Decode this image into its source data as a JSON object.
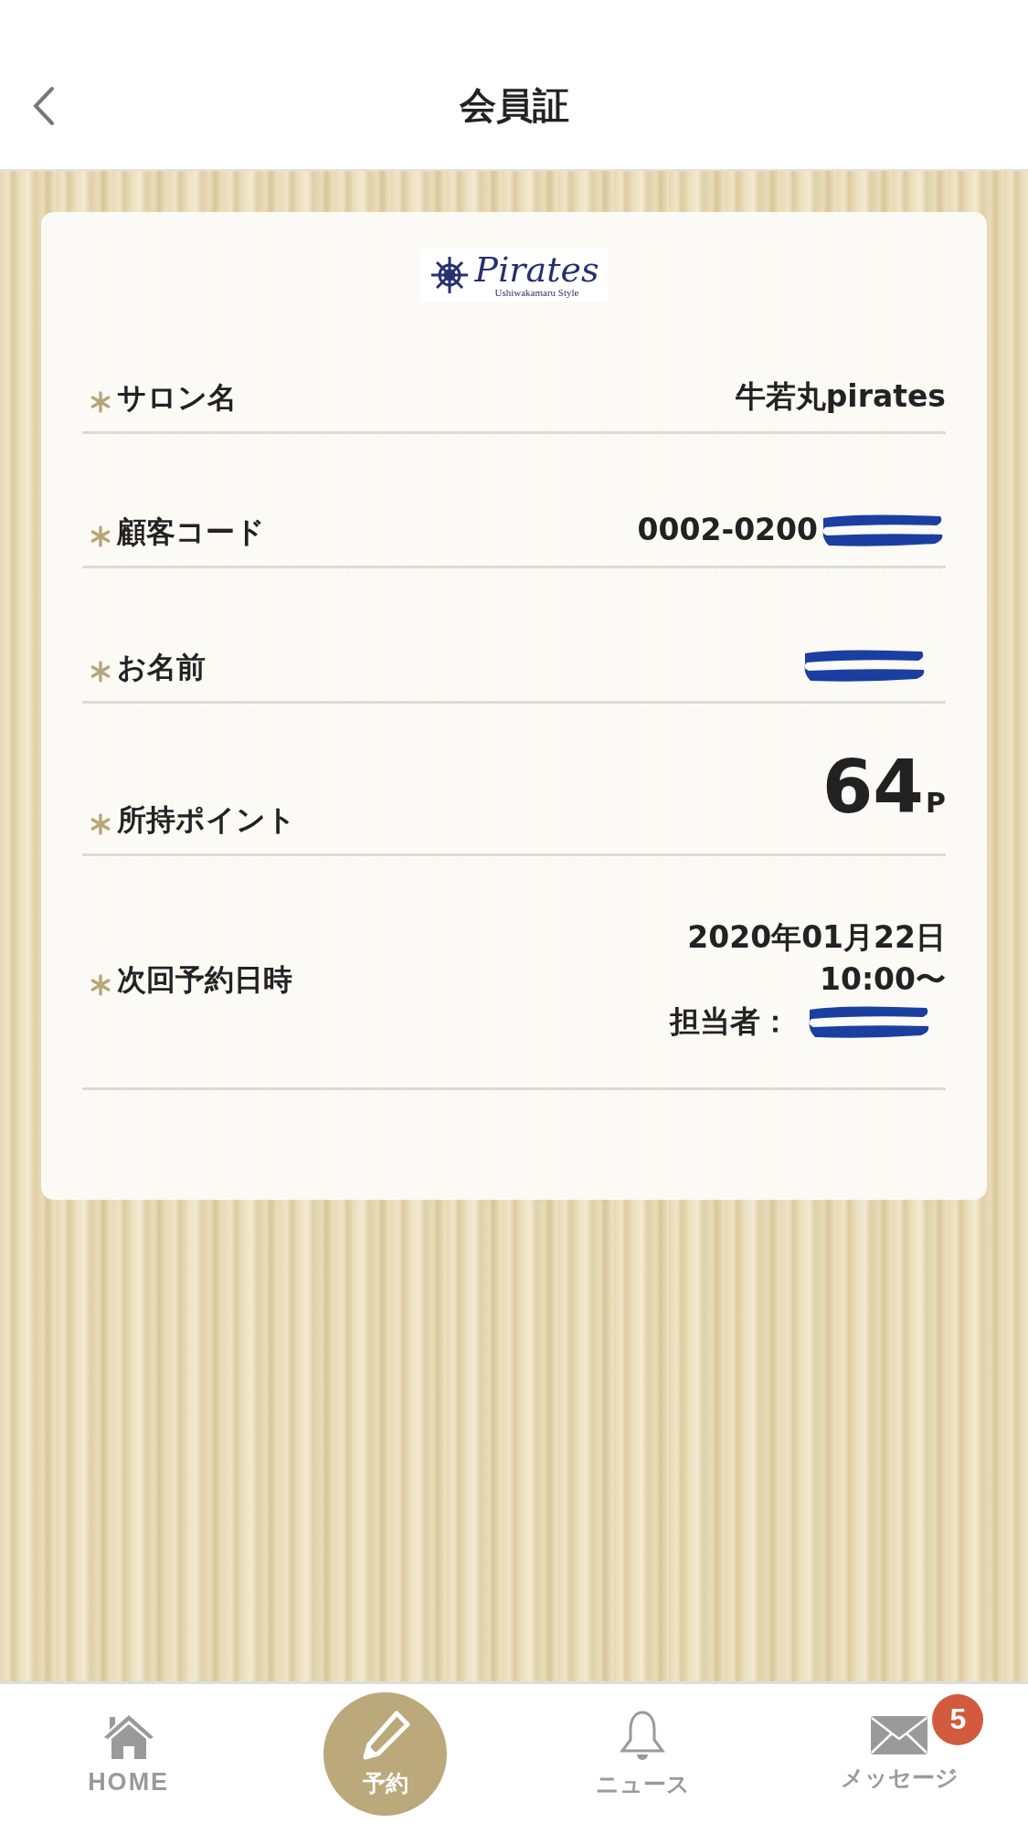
{
  "header": {
    "title": "会員証"
  },
  "card": {
    "logo": {
      "name": "Pirates",
      "tagline": "Ushiwakamaru Style"
    },
    "rows": [
      {
        "kind": "text",
        "label": "サロン名",
        "value": "牛若丸pirates"
      },
      {
        "kind": "partial",
        "label": "顧客コード",
        "value": "0002-0200"
      },
      {
        "kind": "hidden",
        "label": "お名前"
      },
      {
        "kind": "points",
        "label": "所持ポイント",
        "value": "64",
        "unit": "P"
      },
      {
        "kind": "reservation",
        "label": "次回予約日時",
        "date": "2020年01月22日",
        "time": "10:00〜",
        "staff_label": "担当者："
      }
    ]
  },
  "tab_bar": [
    {
      "kind": "home",
      "label": "HOME"
    },
    {
      "kind": "reserve",
      "label": "予約"
    },
    {
      "kind": "news",
      "label": "ニュース"
    },
    {
      "kind": "message",
      "label": "メッセージ",
      "badge": "5"
    }
  ]
}
